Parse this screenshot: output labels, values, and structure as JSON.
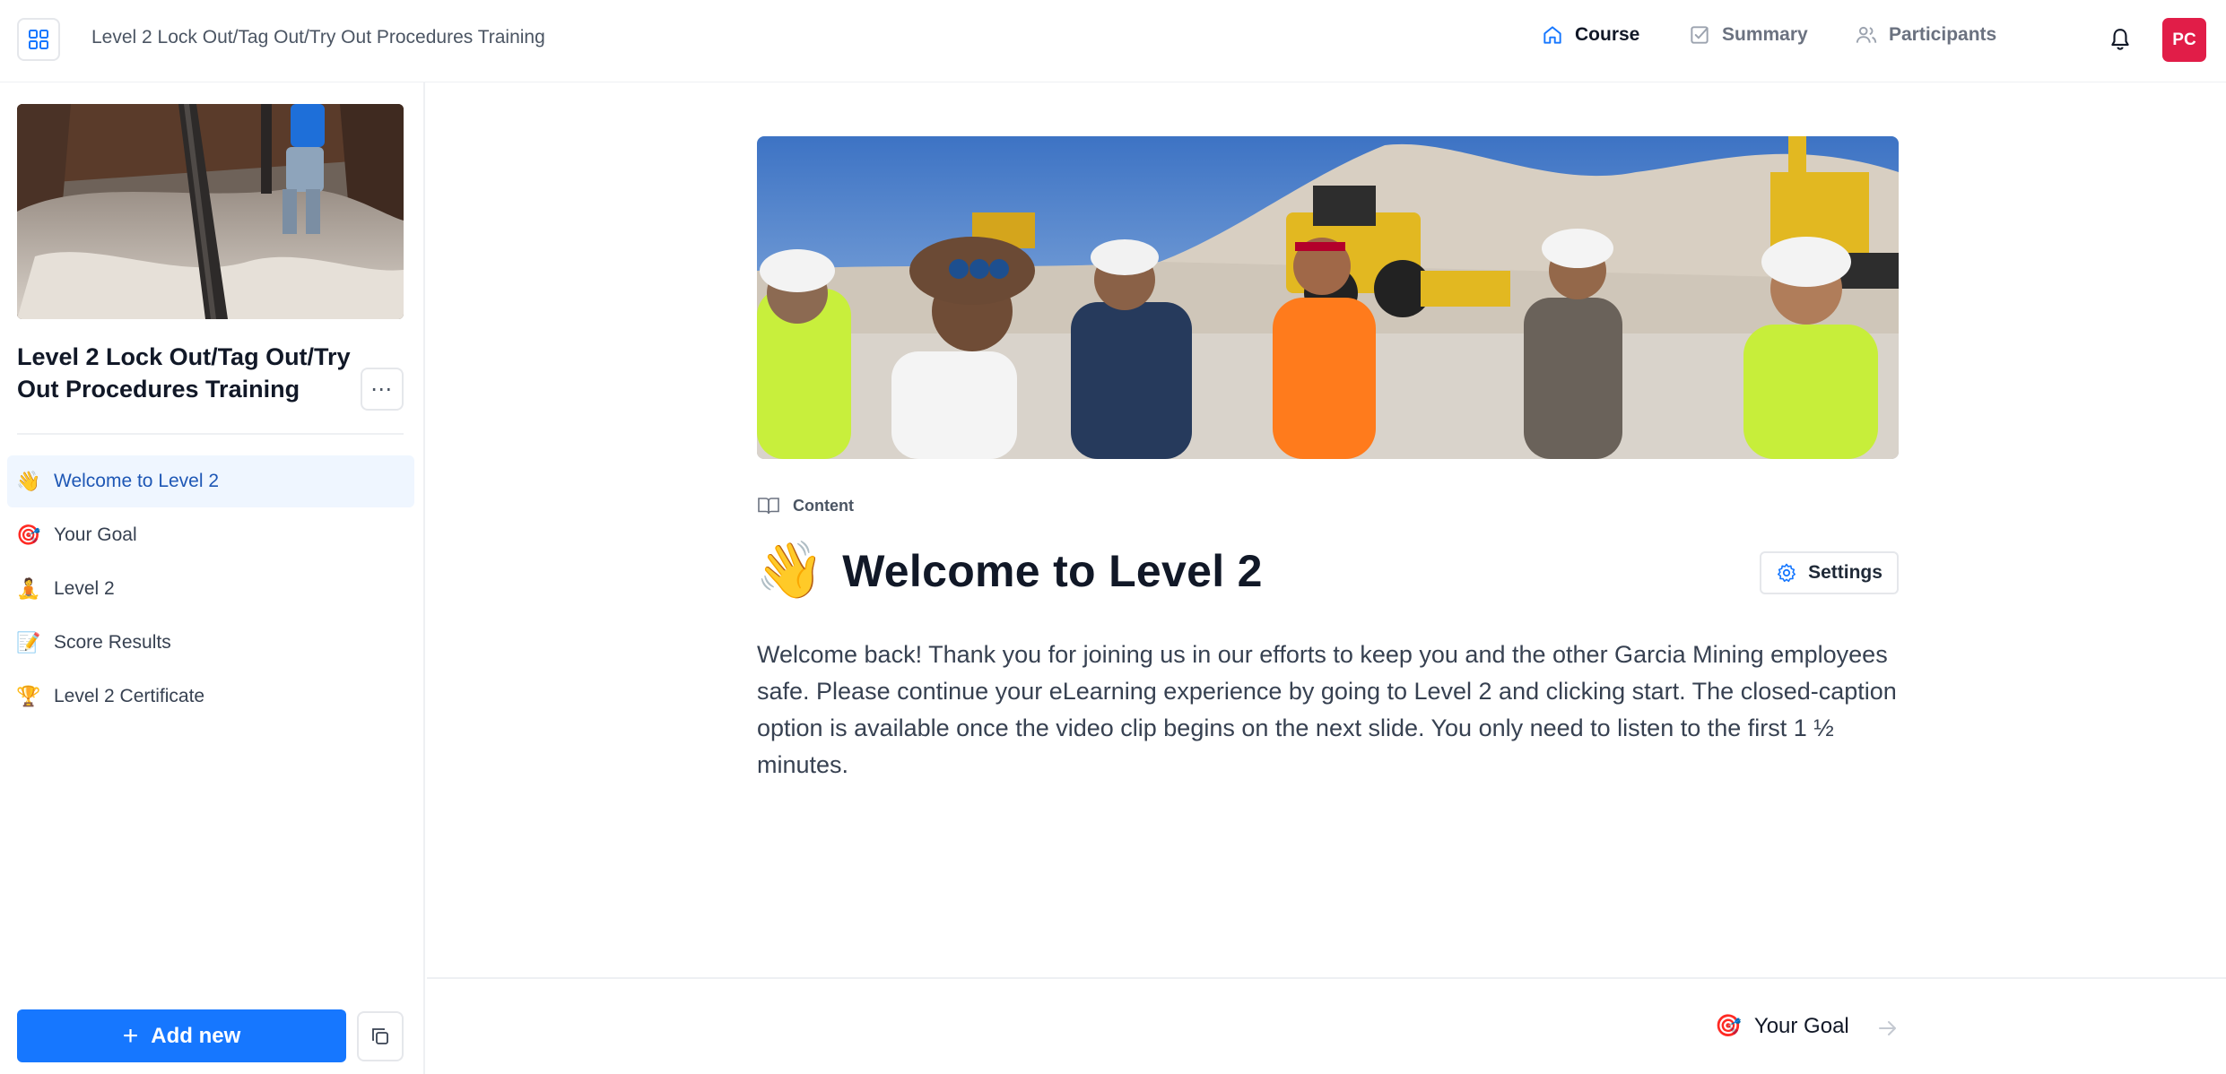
{
  "topbar": {
    "title": "Level 2 Lock Out/Tag Out/Try Out Procedures Training",
    "nav": [
      {
        "label": "Course",
        "icon": "home-icon",
        "active": true
      },
      {
        "label": "Summary",
        "icon": "checkbox-icon",
        "active": false
      },
      {
        "label": "Participants",
        "icon": "users-icon",
        "active": false
      }
    ],
    "avatar_initials": "PC",
    "avatar_color": "#e11d48"
  },
  "sidebar": {
    "course_title": "Level 2 Lock Out/Tag Out/Try Out Procedures Training",
    "more_label": "⋯",
    "lessons": [
      {
        "emoji": "👋",
        "label": "Welcome to Level 2",
        "active": true
      },
      {
        "emoji": "🎯",
        "label": "Your Goal",
        "active": false
      },
      {
        "emoji": "🧘",
        "label": "Level 2",
        "active": false
      },
      {
        "emoji": "📝",
        "label": "Score Results",
        "active": false
      },
      {
        "emoji": "🏆",
        "label": "Level 2 Certificate",
        "active": false
      }
    ],
    "add_new_label": "Add new",
    "add_new_color": "#1677ff"
  },
  "main": {
    "content_tag": "Content",
    "lesson_emoji": "👋",
    "lesson_title": "Welcome to Level 2",
    "settings_label": "Settings",
    "body": "Welcome back!  Thank you for joining us in our efforts to keep you and the other Garcia Mining employees safe. Please continue your eLearning experience by going to Level 2 and clicking start.  The closed-caption option is available once the video clip begins on the next slide.  You only need to listen to the first 1 ½ minutes.",
    "next": {
      "emoji": "🎯",
      "label": "Your Goal"
    }
  }
}
